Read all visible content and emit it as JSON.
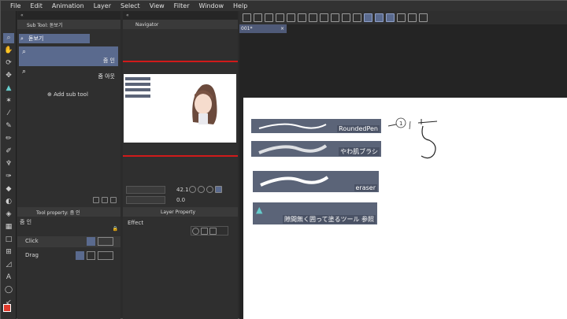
{
  "menu": [
    "File",
    "Edit",
    "Animation",
    "Layer",
    "Select",
    "View",
    "Filter",
    "Window",
    "Help"
  ],
  "subtool": {
    "tab_label": "Sub Tool: 돋보기",
    "title": "돋보기",
    "items": [
      "줌 인",
      "줌 아웃"
    ],
    "add_label": "Add sub tool"
  },
  "navigator": {
    "tab_label": "Navigator",
    "zoom_value": "42.1",
    "rotate_value": "0.0"
  },
  "document": {
    "tab": "001*"
  },
  "brushes": [
    "RoundedPen",
    "やわ肌ブラシ",
    "eraser",
    "隙間無く囲って塗るツール 参照"
  ],
  "annotation": {
    "number": "1"
  },
  "toolprop": {
    "tab_label": "Tool property: 줌 인",
    "title": "줌 인",
    "rows": [
      "Click",
      "Drag"
    ]
  },
  "layerprop": {
    "tab_label": "Layer Property",
    "effect_label": "Effect"
  },
  "colors": {
    "accent": "#5a6a8e",
    "red_line": "#d01a1a",
    "main_color": "#e03a2c"
  }
}
